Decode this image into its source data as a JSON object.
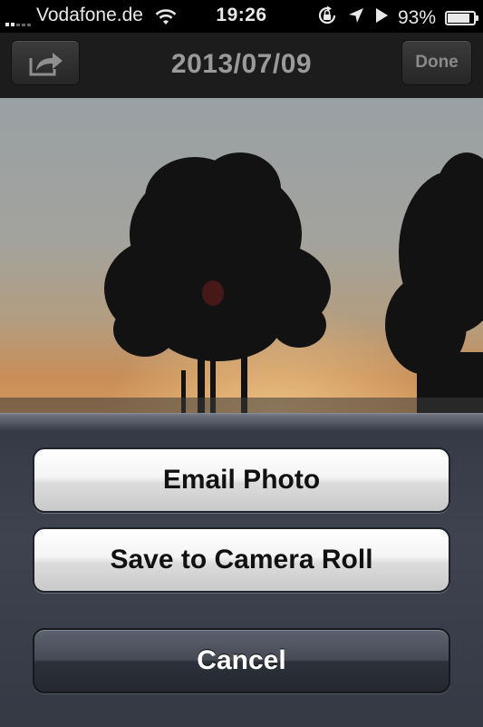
{
  "status_bar": {
    "carrier": "Vodafone.de",
    "time": "19:26",
    "battery_percent": "93%",
    "battery_level": 0.93,
    "signal_bars": 2,
    "icons": [
      "signal-bars-icon",
      "wifi-icon",
      "orientation-lock-icon",
      "location-arrow-icon",
      "play-icon",
      "battery-icon"
    ]
  },
  "nav_bar": {
    "title": "2013/07/09",
    "share_icon": "share-arrow-icon",
    "done_label": "Done"
  },
  "photo": {
    "description_colors": {
      "sky_top": "#9aa1a3",
      "sky_mid": "#a6a296",
      "horizon": "#c98a52",
      "tree": "#111111"
    }
  },
  "action_sheet": {
    "buttons": [
      {
        "label": "Email Photo",
        "style": "default"
      },
      {
        "label": "Save to Camera Roll",
        "style": "default"
      },
      {
        "label": "Cancel",
        "style": "cancel"
      }
    ]
  }
}
